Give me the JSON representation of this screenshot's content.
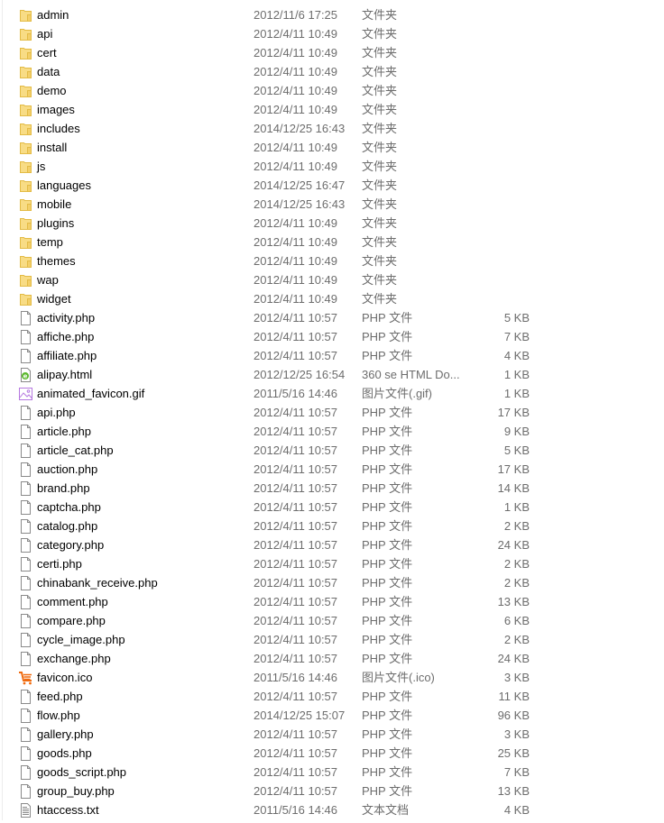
{
  "colors": {
    "folder": "#f5d77a",
    "folder_border": "#e2b93f",
    "text": "#000000",
    "meta_text": "#6d6d6d"
  },
  "files": [
    {
      "name": "admin",
      "date": "2012/11/6 17:25",
      "type": "文件夹",
      "size": "",
      "icon": "folder-icon"
    },
    {
      "name": "api",
      "date": "2012/4/11 10:49",
      "type": "文件夹",
      "size": "",
      "icon": "folder-icon"
    },
    {
      "name": "cert",
      "date": "2012/4/11 10:49",
      "type": "文件夹",
      "size": "",
      "icon": "folder-icon"
    },
    {
      "name": "data",
      "date": "2012/4/11 10:49",
      "type": "文件夹",
      "size": "",
      "icon": "folder-icon"
    },
    {
      "name": "demo",
      "date": "2012/4/11 10:49",
      "type": "文件夹",
      "size": "",
      "icon": "folder-icon"
    },
    {
      "name": "images",
      "date": "2012/4/11 10:49",
      "type": "文件夹",
      "size": "",
      "icon": "folder-icon"
    },
    {
      "name": "includes",
      "date": "2014/12/25 16:43",
      "type": "文件夹",
      "size": "",
      "icon": "folder-icon"
    },
    {
      "name": "install",
      "date": "2012/4/11 10:49",
      "type": "文件夹",
      "size": "",
      "icon": "folder-icon"
    },
    {
      "name": "js",
      "date": "2012/4/11 10:49",
      "type": "文件夹",
      "size": "",
      "icon": "folder-icon"
    },
    {
      "name": "languages",
      "date": "2014/12/25 16:47",
      "type": "文件夹",
      "size": "",
      "icon": "folder-icon"
    },
    {
      "name": "mobile",
      "date": "2014/12/25 16:43",
      "type": "文件夹",
      "size": "",
      "icon": "folder-icon"
    },
    {
      "name": "plugins",
      "date": "2012/4/11 10:49",
      "type": "文件夹",
      "size": "",
      "icon": "folder-icon"
    },
    {
      "name": "temp",
      "date": "2012/4/11 10:49",
      "type": "文件夹",
      "size": "",
      "icon": "folder-icon"
    },
    {
      "name": "themes",
      "date": "2012/4/11 10:49",
      "type": "文件夹",
      "size": "",
      "icon": "folder-icon"
    },
    {
      "name": "wap",
      "date": "2012/4/11 10:49",
      "type": "文件夹",
      "size": "",
      "icon": "folder-icon"
    },
    {
      "name": "widget",
      "date": "2012/4/11 10:49",
      "type": "文件夹",
      "size": "",
      "icon": "folder-icon"
    },
    {
      "name": "activity.php",
      "date": "2012/4/11 10:57",
      "type": "PHP 文件",
      "size": "5 KB",
      "icon": "file-icon"
    },
    {
      "name": "affiche.php",
      "date": "2012/4/11 10:57",
      "type": "PHP 文件",
      "size": "7 KB",
      "icon": "file-icon"
    },
    {
      "name": "affiliate.php",
      "date": "2012/4/11 10:57",
      "type": "PHP 文件",
      "size": "4 KB",
      "icon": "file-icon"
    },
    {
      "name": "alipay.html",
      "date": "2012/12/25 16:54",
      "type": "360 se HTML Do...",
      "size": "1 KB",
      "icon": "html-file-icon"
    },
    {
      "name": "animated_favicon.gif",
      "date": "2011/5/16 14:46",
      "type": "图片文件(.gif)",
      "size": "1 KB",
      "icon": "image-file-icon"
    },
    {
      "name": "api.php",
      "date": "2012/4/11 10:57",
      "type": "PHP 文件",
      "size": "17 KB",
      "icon": "file-icon"
    },
    {
      "name": "article.php",
      "date": "2012/4/11 10:57",
      "type": "PHP 文件",
      "size": "9 KB",
      "icon": "file-icon"
    },
    {
      "name": "article_cat.php",
      "date": "2012/4/11 10:57",
      "type": "PHP 文件",
      "size": "5 KB",
      "icon": "file-icon"
    },
    {
      "name": "auction.php",
      "date": "2012/4/11 10:57",
      "type": "PHP 文件",
      "size": "17 KB",
      "icon": "file-icon"
    },
    {
      "name": "brand.php",
      "date": "2012/4/11 10:57",
      "type": "PHP 文件",
      "size": "14 KB",
      "icon": "file-icon"
    },
    {
      "name": "captcha.php",
      "date": "2012/4/11 10:57",
      "type": "PHP 文件",
      "size": "1 KB",
      "icon": "file-icon"
    },
    {
      "name": "catalog.php",
      "date": "2012/4/11 10:57",
      "type": "PHP 文件",
      "size": "2 KB",
      "icon": "file-icon"
    },
    {
      "name": "category.php",
      "date": "2012/4/11 10:57",
      "type": "PHP 文件",
      "size": "24 KB",
      "icon": "file-icon"
    },
    {
      "name": "certi.php",
      "date": "2012/4/11 10:57",
      "type": "PHP 文件",
      "size": "2 KB",
      "icon": "file-icon"
    },
    {
      "name": "chinabank_receive.php",
      "date": "2012/4/11 10:57",
      "type": "PHP 文件",
      "size": "2 KB",
      "icon": "file-icon"
    },
    {
      "name": "comment.php",
      "date": "2012/4/11 10:57",
      "type": "PHP 文件",
      "size": "13 KB",
      "icon": "file-icon"
    },
    {
      "name": "compare.php",
      "date": "2012/4/11 10:57",
      "type": "PHP 文件",
      "size": "6 KB",
      "icon": "file-icon"
    },
    {
      "name": "cycle_image.php",
      "date": "2012/4/11 10:57",
      "type": "PHP 文件",
      "size": "2 KB",
      "icon": "file-icon"
    },
    {
      "name": "exchange.php",
      "date": "2012/4/11 10:57",
      "type": "PHP 文件",
      "size": "24 KB",
      "icon": "file-icon"
    },
    {
      "name": "favicon.ico",
      "date": "2011/5/16 14:46",
      "type": "图片文件(.ico)",
      "size": "3 KB",
      "icon": "cart-icon"
    },
    {
      "name": "feed.php",
      "date": "2012/4/11 10:57",
      "type": "PHP 文件",
      "size": "11 KB",
      "icon": "file-icon"
    },
    {
      "name": "flow.php",
      "date": "2014/12/25 15:07",
      "type": "PHP 文件",
      "size": "96 KB",
      "icon": "file-icon"
    },
    {
      "name": "gallery.php",
      "date": "2012/4/11 10:57",
      "type": "PHP 文件",
      "size": "3 KB",
      "icon": "file-icon"
    },
    {
      "name": "goods.php",
      "date": "2012/4/11 10:57",
      "type": "PHP 文件",
      "size": "25 KB",
      "icon": "file-icon"
    },
    {
      "name": "goods_script.php",
      "date": "2012/4/11 10:57",
      "type": "PHP 文件",
      "size": "7 KB",
      "icon": "file-icon"
    },
    {
      "name": "group_buy.php",
      "date": "2012/4/11 10:57",
      "type": "PHP 文件",
      "size": "13 KB",
      "icon": "file-icon"
    },
    {
      "name": "htaccess.txt",
      "date": "2011/5/16 14:46",
      "type": "文本文档",
      "size": "4 KB",
      "icon": "text-file-icon"
    }
  ]
}
